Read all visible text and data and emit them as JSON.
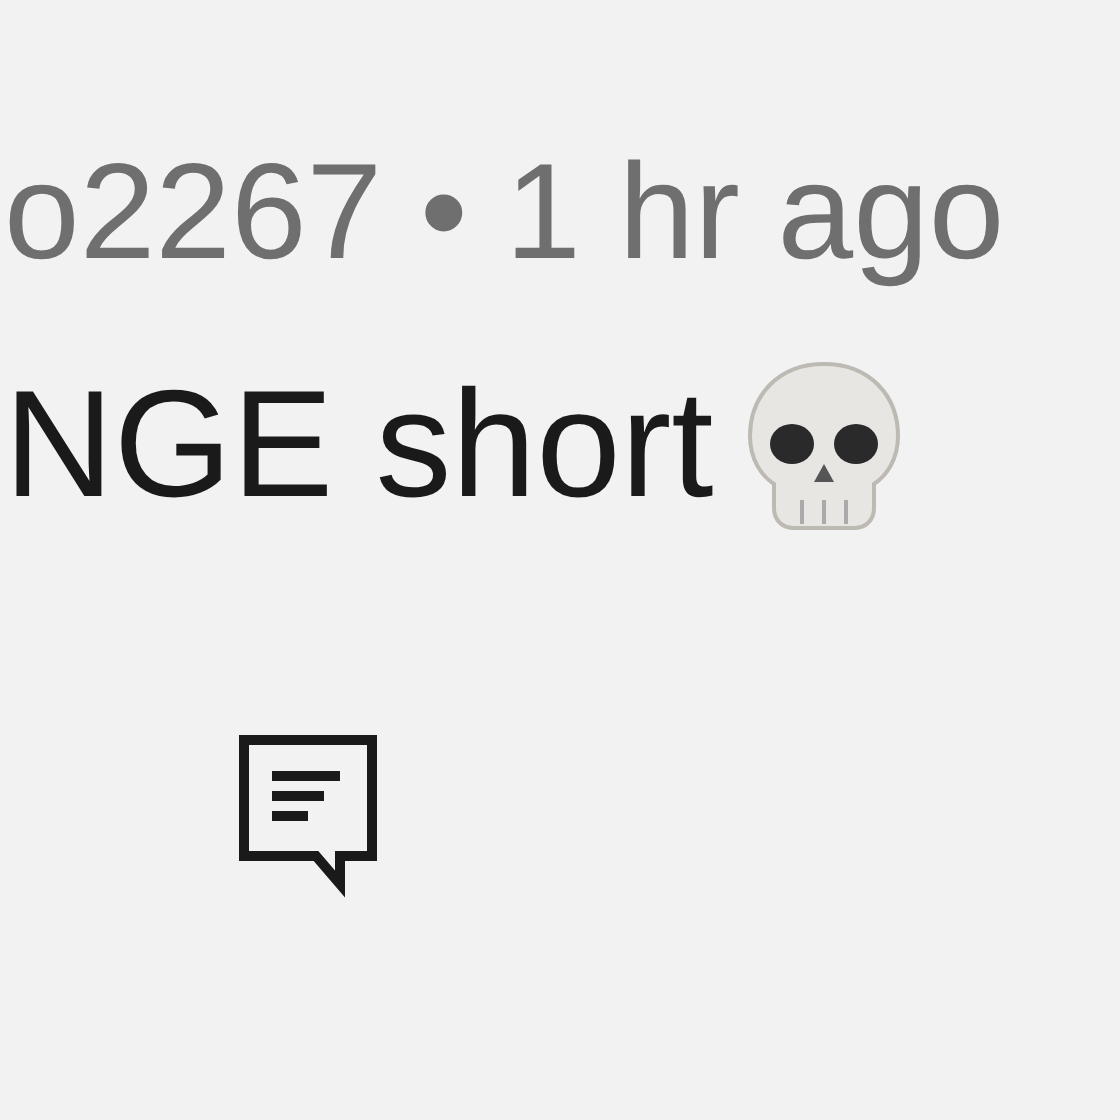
{
  "comment": {
    "meta": "o2267 • 1 hr ago",
    "body": "NGE short"
  }
}
